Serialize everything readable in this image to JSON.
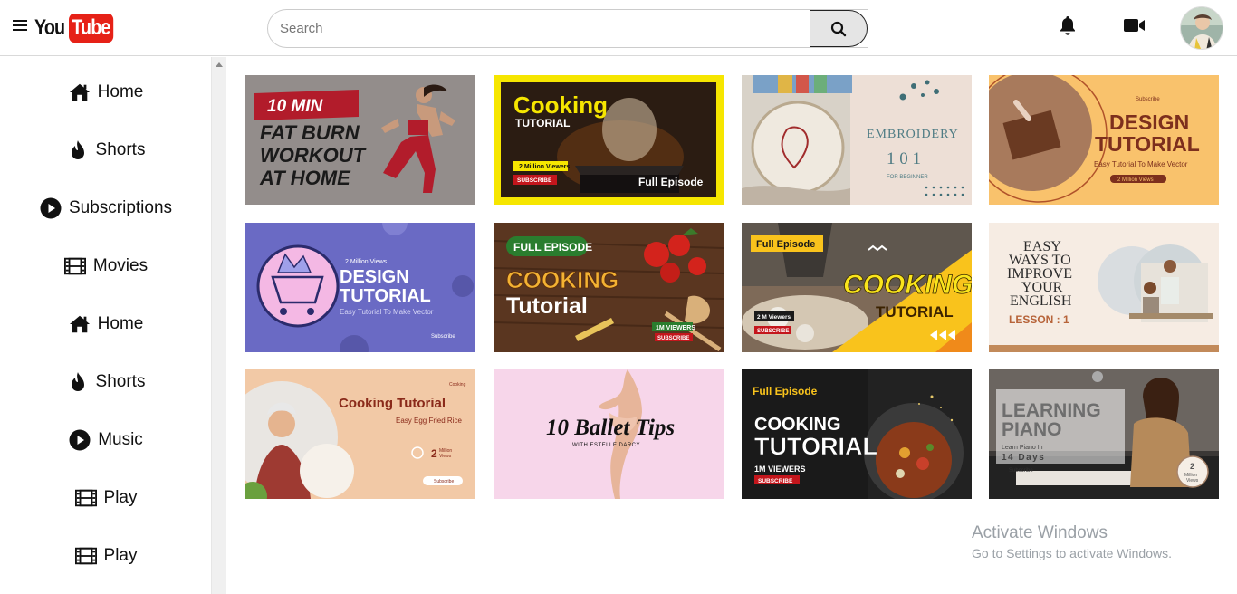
{
  "header": {
    "logo_you": "You",
    "logo_tube": "Tube",
    "search_placeholder": "Search"
  },
  "sidebar": {
    "items": [
      {
        "label": "Home",
        "icon": "home-icon"
      },
      {
        "label": "Shorts",
        "icon": "flame-icon"
      },
      {
        "label": "Subscriptions",
        "icon": "play-circle-icon"
      },
      {
        "label": "Movies",
        "icon": "film-icon"
      },
      {
        "label": "Home",
        "icon": "home-icon"
      },
      {
        "label": "Shorts",
        "icon": "flame-icon"
      },
      {
        "label": "Music",
        "icon": "play-circle-icon"
      },
      {
        "label": "Play",
        "icon": "film-icon"
      },
      {
        "label": "Play",
        "icon": "film-icon"
      }
    ]
  },
  "videos": [
    {
      "line1": "10 MIN",
      "line2": "FAT BURN",
      "line3": "WORKOUT",
      "line4": "AT HOME"
    },
    {
      "title": "Cooking",
      "sub": "TUTORIAL",
      "views": "2 Million Viewers",
      "subscribe": "SUBSCRIBE",
      "episode": "Full Episode"
    },
    {
      "title": "EMBROIDERY",
      "num": "1 0 1",
      "sub": "FOR BEGINNER"
    },
    {
      "badge": "Subscribe",
      "title1": "DESIGN",
      "title2": "TUTORIAL",
      "sub": "Easy Tutorial To Make Vector",
      "views": "2 Million Views"
    },
    {
      "views": "2 Million Views",
      "title1": "DESIGN",
      "title2": "TUTORIAL",
      "sub": "Easy Tutorial To Make Vector",
      "subscribe": "Subscribe"
    },
    {
      "episode": "FULL EPISODE",
      "title1": "COOKING",
      "title2": "Tutorial",
      "views": "1M VIEWERS",
      "subscribe": "SUBSCRIBE"
    },
    {
      "episode": "Full Episode",
      "views": "2 M Viewers",
      "subscribe": "SUBSCRIBE",
      "title1": "COOKING",
      "title2": "TUTORIAL"
    },
    {
      "l1": "EASY",
      "l2": "WAYS TO",
      "l3": "IMPROVE",
      "l4": "YOUR",
      "l5": "ENGLISH",
      "lesson": "LESSON : 1"
    },
    {
      "badge": "Cooking",
      "title": "Cooking Tutorial",
      "sub": "Easy Egg Fried Rice",
      "views_num": "2",
      "views_txt1": "Million",
      "views_txt2": "Views",
      "subscribe": "Subscribe"
    },
    {
      "title": "10 Ballet Tips",
      "sub": "WITH ESTELLE DARCY"
    },
    {
      "episode": "Full Episode",
      "title1": "COOKING",
      "title2": "TUTORIAL",
      "views": "1M VIEWERS",
      "subscribe": "SUBSCRIBE"
    },
    {
      "title1": "LEARNING",
      "title2": "PIANO",
      "sub1": "Learn Piano In",
      "sub2": "14 Days",
      "subscribe": "Subscribe",
      "views_num": "2",
      "views_txt1": "Million",
      "views_txt2": "Views"
    }
  ],
  "watermark": {
    "line1": "Activate Windows",
    "line2": "Go to Settings to activate Windows."
  },
  "colors": {
    "logo_red": "#e62117",
    "search_btn_bg": "#e5e5e5"
  }
}
